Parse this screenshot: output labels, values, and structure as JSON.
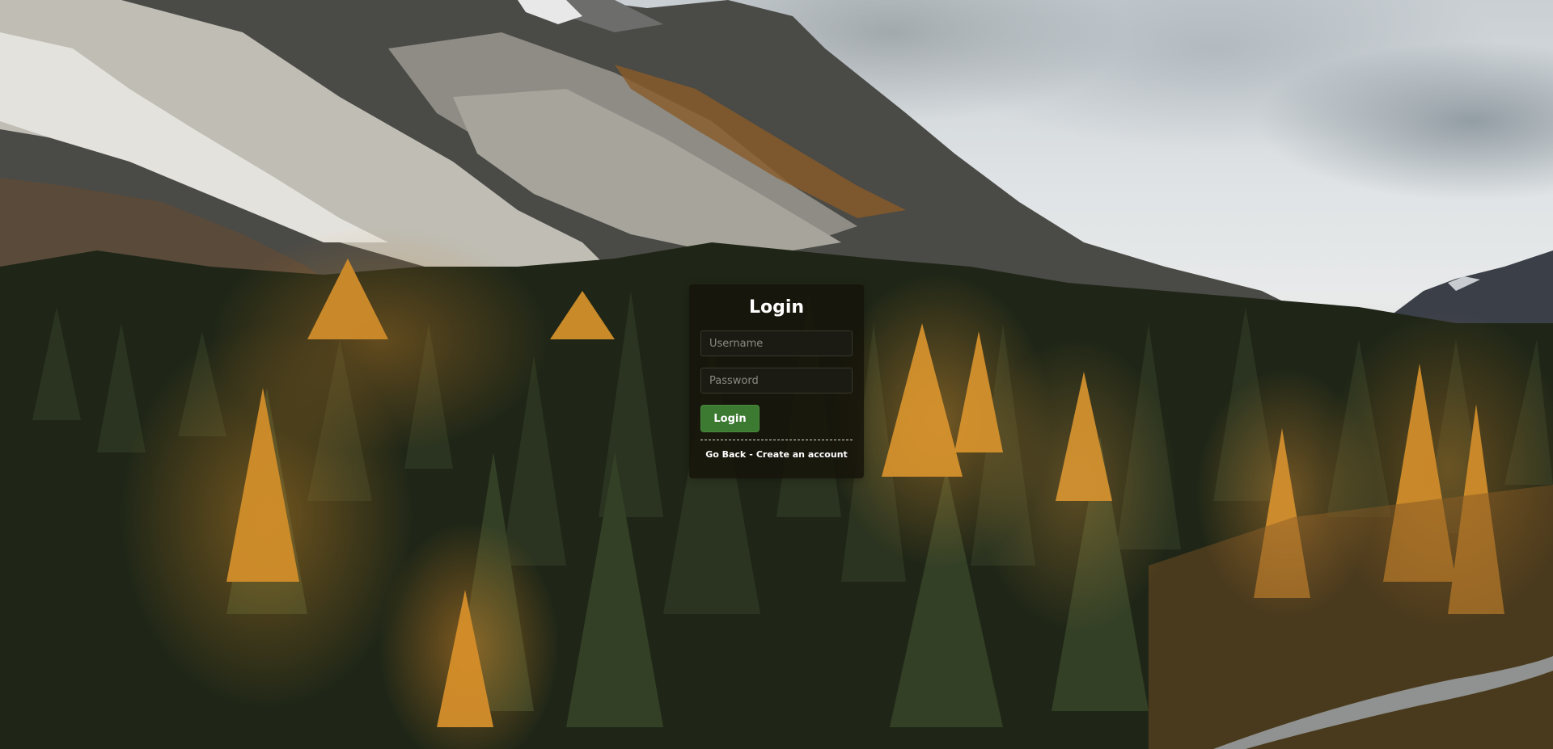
{
  "login": {
    "title": "Login",
    "username_placeholder": "Username",
    "password_placeholder": "Password",
    "submit_label": "Login",
    "back_link": "Go Back",
    "separator": "-",
    "create_link": "Create an account"
  },
  "colors": {
    "card_background": "#16140a",
    "button_green": "#3c7a32",
    "text": "#ffffff"
  },
  "background": {
    "description_icon": "mountain-forest-photo"
  }
}
